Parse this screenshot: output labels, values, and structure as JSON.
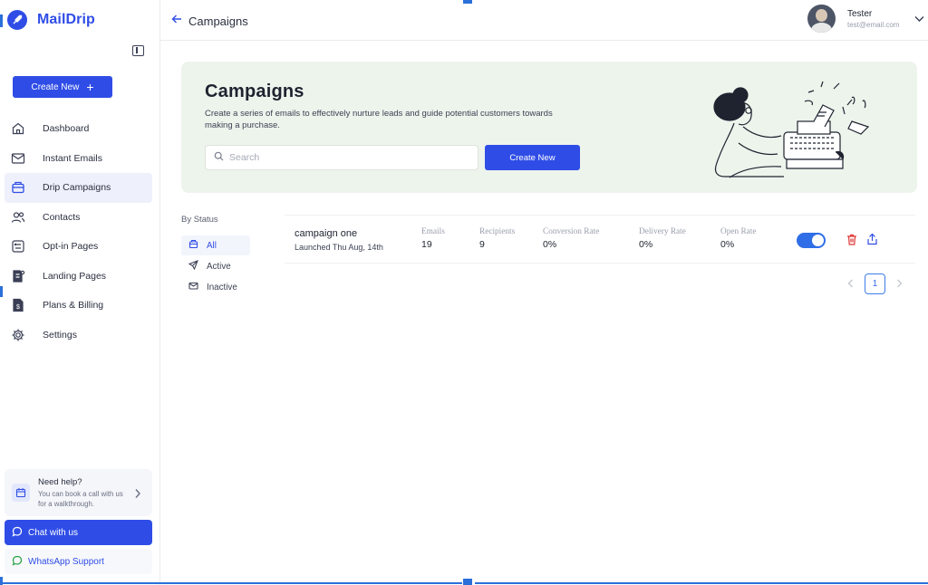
{
  "brand": {
    "name": "MailDrip"
  },
  "sidebar": {
    "create_label": "Create New",
    "items": [
      {
        "label": "Dashboard",
        "icon": "home-icon",
        "active": false
      },
      {
        "label": "Instant Emails",
        "icon": "mail-icon",
        "active": false
      },
      {
        "label": "Drip Campaigns",
        "icon": "campaign-icon",
        "active": true
      },
      {
        "label": "Contacts",
        "icon": "contacts-icon",
        "active": false
      },
      {
        "label": "Opt-in Pages",
        "icon": "form-icon",
        "active": false
      },
      {
        "label": "Landing Pages",
        "icon": "landing-icon",
        "active": false
      },
      {
        "label": "Plans & Billing",
        "icon": "billing-icon",
        "active": false
      },
      {
        "label": "Settings",
        "icon": "gear-icon",
        "active": false
      }
    ],
    "help": {
      "title": "Need help?",
      "subtitle": "You can book a call with us for a walkthrough."
    },
    "chat_label": "Chat with us",
    "whatsapp_label": "WhatsApp Support"
  },
  "header": {
    "title": "Campaigns",
    "user": {
      "name": "Tester",
      "email": "test@email.com"
    }
  },
  "hero": {
    "title": "Campaigns",
    "description": "Create a series of emails to effectively nurture leads and guide potential customers towards making a purchase.",
    "search_placeholder": "Search",
    "create_label": "Create New"
  },
  "filter": {
    "title": "By Status",
    "items": [
      {
        "label": "All",
        "active": true
      },
      {
        "label": "Active",
        "active": false
      },
      {
        "label": "Inactive",
        "active": false
      }
    ]
  },
  "campaigns": [
    {
      "name": "campaign one",
      "launched": "Launched Thu Aug, 14th",
      "stats": [
        {
          "label": "Emails",
          "value": "19"
        },
        {
          "label": "Recipients",
          "value": "9"
        },
        {
          "label": "Conversion Rate",
          "value": "0%"
        },
        {
          "label": "Delivery Rate",
          "value": "0%"
        },
        {
          "label": "Open Rate",
          "value": "0%"
        }
      ],
      "enabled": true
    }
  ],
  "pagination": {
    "current": "1"
  },
  "colors": {
    "accent": "#2f4de6",
    "hero_bg": "#edf4ec",
    "danger": "#e03535"
  }
}
